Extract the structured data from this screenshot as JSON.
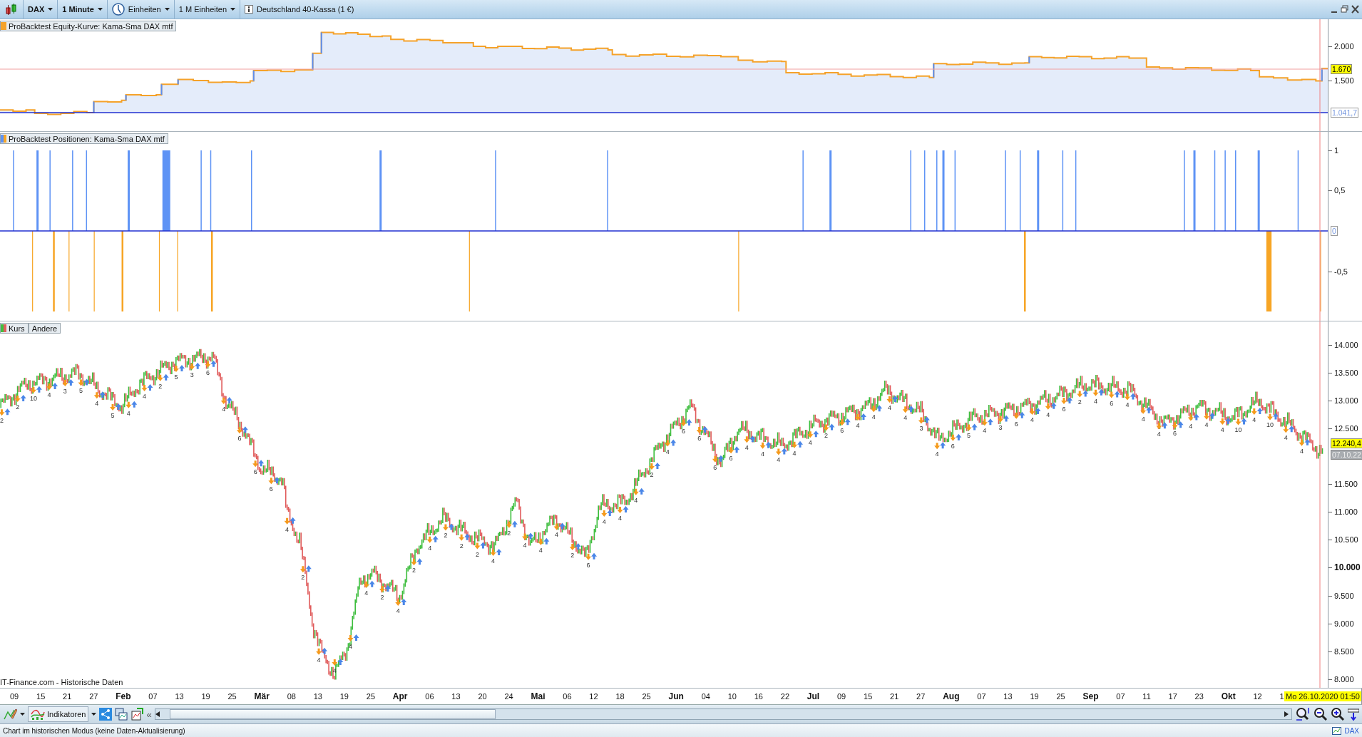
{
  "toolbar": {
    "instrument": "DAX",
    "timeframe": "1 Minute",
    "units": "Einheiten",
    "unit_count": "1 M Einheiten",
    "market": "Deutschland 40-Kassa (1 €)"
  },
  "panels": [
    {
      "kind": "equity",
      "legends": [
        "ProBacktest Equity-Kurve: Kama-Sma DAX mtf"
      ],
      "axis_labels": [
        {
          "label": "2.000",
          "bold": false
        },
        {
          "label": "1.500",
          "bold": false
        }
      ],
      "badges": [
        {
          "kind": "current",
          "text": "1.670"
        },
        {
          "kind": "level",
          "text": "1.041,7"
        }
      ]
    },
    {
      "kind": "positions",
      "legends": [
        "ProBacktest Positionen: Kama-Sma DAX mtf"
      ],
      "axis_labels": [
        {
          "label": "1",
          "bold": false
        },
        {
          "label": "0,5",
          "bold": false
        },
        {
          "label": "-0,5",
          "bold": false
        }
      ],
      "badges": [
        {
          "kind": "level",
          "text": "0"
        }
      ]
    },
    {
      "kind": "price",
      "legends": [
        "Kurs",
        "Andere"
      ],
      "axis_labels": [
        {
          "label": "14.000",
          "bold": false
        },
        {
          "label": "13.500",
          "bold": false
        },
        {
          "label": "13.000",
          "bold": false
        },
        {
          "label": "12.500",
          "bold": false
        },
        {
          "label": "11.500",
          "bold": false
        },
        {
          "label": "11.000",
          "bold": false
        },
        {
          "label": "10.500",
          "bold": false
        },
        {
          "label": "10.000",
          "bold": true
        },
        {
          "label": "9.500",
          "bold": false
        },
        {
          "label": "9.000",
          "bold": false
        },
        {
          "label": "8.500",
          "bold": false
        },
        {
          "label": "8.000",
          "bold": false
        }
      ],
      "badges": [
        {
          "kind": "current",
          "text": "12.240,4"
        },
        {
          "kind": "time",
          "text": "07.10.22"
        }
      ],
      "trade_labels": [
        "2",
        "2",
        "10",
        "4",
        "3",
        "5",
        "4",
        "5",
        "4",
        "4",
        "2",
        "5",
        "3",
        "6",
        "4",
        "6",
        "6",
        "6",
        "4",
        "2",
        "4",
        "4",
        "4",
        "4",
        "2",
        "4",
        "2",
        "4",
        "2",
        "2",
        "2",
        "4",
        "2",
        "4",
        "4",
        "4",
        "2",
        "6",
        "4",
        "4",
        "4",
        "2",
        "4",
        "6",
        "6",
        "6",
        "6",
        "4",
        "4",
        "4",
        "4",
        "4",
        "2",
        "6",
        "4",
        "4",
        "4",
        "4",
        "3",
        "4",
        "6",
        "5",
        "4",
        "3",
        "6",
        "4",
        "4",
        "6",
        "2",
        "4",
        "6",
        "4",
        "4",
        "4",
        "6",
        "4",
        "4",
        "4",
        "10",
        "4",
        "10",
        "4",
        "4"
      ],
      "source": "IT-Finance.com - Historische Daten"
    }
  ],
  "x_axis": {
    "labels": [
      {
        "label": "09",
        "bold": false
      },
      {
        "label": "15",
        "bold": false
      },
      {
        "label": "21",
        "bold": false
      },
      {
        "label": "27",
        "bold": false
      },
      {
        "label": "Feb",
        "bold": true
      },
      {
        "label": "07",
        "bold": false
      },
      {
        "label": "13",
        "bold": false
      },
      {
        "label": "19",
        "bold": false
      },
      {
        "label": "25",
        "bold": false
      },
      {
        "label": "Mär",
        "bold": true
      },
      {
        "label": "08",
        "bold": false
      },
      {
        "label": "13",
        "bold": false
      },
      {
        "label": "19",
        "bold": false
      },
      {
        "label": "25",
        "bold": false
      },
      {
        "label": "Apr",
        "bold": true
      },
      {
        "label": "06",
        "bold": false
      },
      {
        "label": "13",
        "bold": false
      },
      {
        "label": "20",
        "bold": false
      },
      {
        "label": "24",
        "bold": false
      },
      {
        "label": "Mai",
        "bold": true
      },
      {
        "label": "06",
        "bold": false
      },
      {
        "label": "12",
        "bold": false
      },
      {
        "label": "18",
        "bold": false
      },
      {
        "label": "25",
        "bold": false
      },
      {
        "label": "Jun",
        "bold": true
      },
      {
        "label": "04",
        "bold": false
      },
      {
        "label": "10",
        "bold": false
      },
      {
        "label": "16",
        "bold": false
      },
      {
        "label": "22",
        "bold": false
      },
      {
        "label": "Jul",
        "bold": true
      },
      {
        "label": "09",
        "bold": false
      },
      {
        "label": "15",
        "bold": false
      },
      {
        "label": "21",
        "bold": false
      },
      {
        "label": "27",
        "bold": false
      },
      {
        "label": "Aug",
        "bold": true
      },
      {
        "label": "07",
        "bold": false
      },
      {
        "label": "13",
        "bold": false
      },
      {
        "label": "19",
        "bold": false
      },
      {
        "label": "25",
        "bold": false
      },
      {
        "label": "Sep",
        "bold": true
      },
      {
        "label": "07",
        "bold": false
      },
      {
        "label": "11",
        "bold": false
      },
      {
        "label": "17",
        "bold": false
      },
      {
        "label": "23",
        "bold": false
      },
      {
        "label": "Okt",
        "bold": true
      },
      {
        "label": "12",
        "bold": false
      },
      {
        "label": "1",
        "bold": false
      }
    ],
    "cursor_date": "Mo 26.10.2020 01:50"
  },
  "bottom_bar": {
    "indicators": "Indikatoren",
    "collapse": "«"
  },
  "status_bar": {
    "text": "Chart im historischen Modus (keine Daten-Aktualisierung)",
    "instrument": "DAX"
  }
}
